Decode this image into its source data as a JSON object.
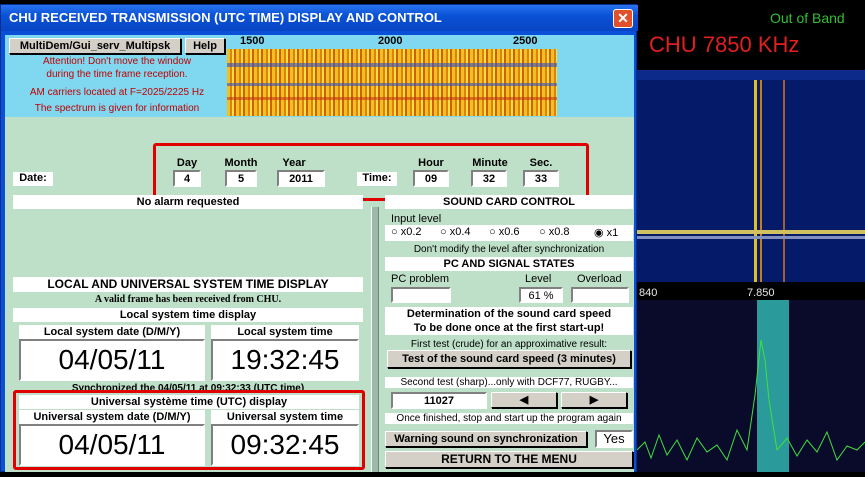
{
  "window": {
    "title": "CHU RECEIVED TRANSMISSION (UTC TIME) DISPLAY AND CONTROL",
    "close": "✕"
  },
  "toolbar": {
    "source_button": "MultiDem/Gui_serv_Multipsk",
    "help_button": "Help"
  },
  "warnings": {
    "line1": "Attention! Don't move the window",
    "line2": "during the time frame reception.",
    "line3": "AM carriers located at F=2025/2225 Hz",
    "line4": "The spectrum is given for information"
  },
  "spectrum": {
    "ticks": [
      "1500",
      "2000",
      "2500"
    ]
  },
  "date": {
    "label": "Date:",
    "day_label": "Day",
    "day": "4",
    "month_label": "Month",
    "month": "5",
    "year_label": "Year",
    "year": "2011"
  },
  "time": {
    "label": "Time:",
    "hour_label": "Hour",
    "hour": "09",
    "minute_label": "Minute",
    "minute": "32",
    "sec_label": "Sec.",
    "sec": "33"
  },
  "alarm": "No alarm requested",
  "local": {
    "heading": "LOCAL AND UNIVERSAL SYSTEM TIME DISPLAY",
    "valid_frame": "A valid frame has been received from CHU.",
    "sys_display": "Local system time display",
    "date_label": "Local system date (D/M/Y)",
    "date": "04/05/11",
    "time_label": "Local system time",
    "time": "19:32:45",
    "synced": "Synchronized the 04/05/11 at 09:32:33 (UTC time)"
  },
  "utc": {
    "heading": "Universal  système time (UTC) display",
    "date_label": "Universal system date (D/M/Y)",
    "date": "04/05/11",
    "time_label": "Universal system time",
    "time": "09:32:45"
  },
  "sound": {
    "heading": "SOUND CARD CONTROL",
    "input_level": "Input level",
    "options": [
      "x0.2",
      "x0.4",
      "x0.6",
      "x0.8",
      "x1"
    ],
    "selected": "x1",
    "note": "Don't modify the level after synchronization",
    "states": "PC AND SIGNAL STATES",
    "pc_problem": "PC problem",
    "level_label": "Level",
    "level": "61 %",
    "overload": "Overload"
  },
  "speed": {
    "heading1": "Determination of the sound card speed",
    "heading2": "To be done once at the first start-up!",
    "first_test": "First test (crude) for an approximative result:",
    "test_button": "Test of the sound card speed (3 minutes)",
    "second_test": "Second test (sharp)...only with DCF77, RUGBY...",
    "value": "11027",
    "left": "◀",
    "right": "▶",
    "once": "Once finished, stop and start up the program again"
  },
  "warn_sound": {
    "label": "Warning sound on synchronization",
    "value": "Yes"
  },
  "return_button": "RETURN TO THE MENU",
  "right_panel": {
    "status": "Out of Band",
    "freq": "CHU 7850 KHz",
    "axis_left": "840",
    "axis_mid": "7.850"
  }
}
